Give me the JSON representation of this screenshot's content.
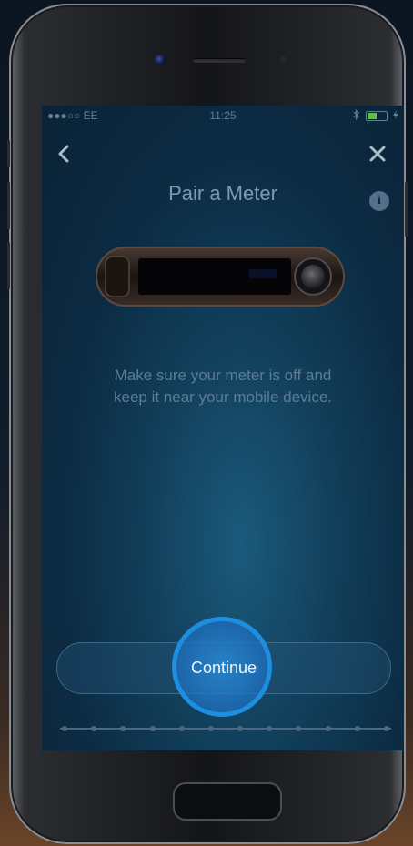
{
  "status_bar": {
    "carrier": "●●●○○ EE",
    "time": "11:25",
    "bluetooth_icon": "bluetooth-icon",
    "battery_icon": "battery-icon",
    "battery_color": "#5fbf4a"
  },
  "nav": {
    "back_icon": "chevron-left-icon",
    "close_icon": "close-icon"
  },
  "page": {
    "title": "Pair a Meter",
    "info_icon_glyph": "i",
    "instructions_line1": "Make sure your meter is off and",
    "instructions_line2": "keep it near your mobile device."
  },
  "actions": {
    "continue_label": "Continue"
  },
  "progress": {
    "steps": 12
  },
  "colors": {
    "accent": "#1e8ee0",
    "screen_bg": "#0c2c44"
  }
}
